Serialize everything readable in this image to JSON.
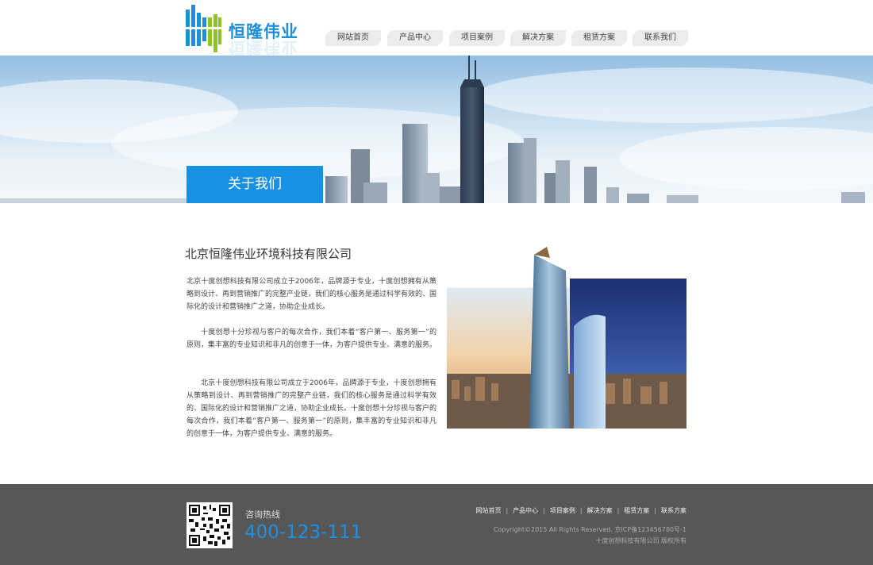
{
  "brand": {
    "name": "恒隆伟业",
    "colors": {
      "blue": "#1891e4",
      "green": "#8fc31f"
    }
  },
  "nav": {
    "items": [
      {
        "label": "网站首页"
      },
      {
        "label": "产品中心"
      },
      {
        "label": "项目案例"
      },
      {
        "label": "解决方案"
      },
      {
        "label": "租赁方案"
      },
      {
        "label": "联系我们"
      }
    ]
  },
  "banner": {
    "tab_label": "关于我们"
  },
  "content": {
    "title": "北京恒隆伟业环境科技有限公司",
    "paragraphs": [
      "北京十度创想科技有限公司成立于2006年，品牌源于专业，十度创想拥有从策略到设计、再到营销推广的完整产业链，我们的核心服务是通过科学有效的、国际化的设计和营销推广之道，协助企业成长。",
      "十度创想十分珍视与客户的每次合作，我们本着“客户第一、服务第一”的原则，集丰富的专业知识和非凡的创意于一体，为客户提供专业、满意的服务。",
      "北京十度创想科技有限公司成立于2006年，品牌源于专业，十度创想拥有从策略到设计、再到营销推广的完整产业链，我们的核心服务是通过科学有效的、国际化的设计和营销推广之道，协助企业成长。十度创想十分珍视与客户的每次合作，我们本着“客户第一、服务第一”的原则，集丰富的专业知识和非凡的创意于一体，为客户提供专业、满意的服务。"
    ]
  },
  "footer": {
    "hotline_label": "咨询热线",
    "hotline_number": "400-123-111",
    "nav": [
      {
        "label": "网站首页"
      },
      {
        "label": "产品中心"
      },
      {
        "label": "项目案例"
      },
      {
        "label": "解决方案"
      },
      {
        "label": "租赁方案"
      },
      {
        "label": "联系方案"
      }
    ],
    "separator": "|",
    "copyright_line1": "Copyright©2015 All Rights Reserved. 京ICP备123456780号-1",
    "copyright_line2": "十度创想科技有限公司 版权所有"
  }
}
